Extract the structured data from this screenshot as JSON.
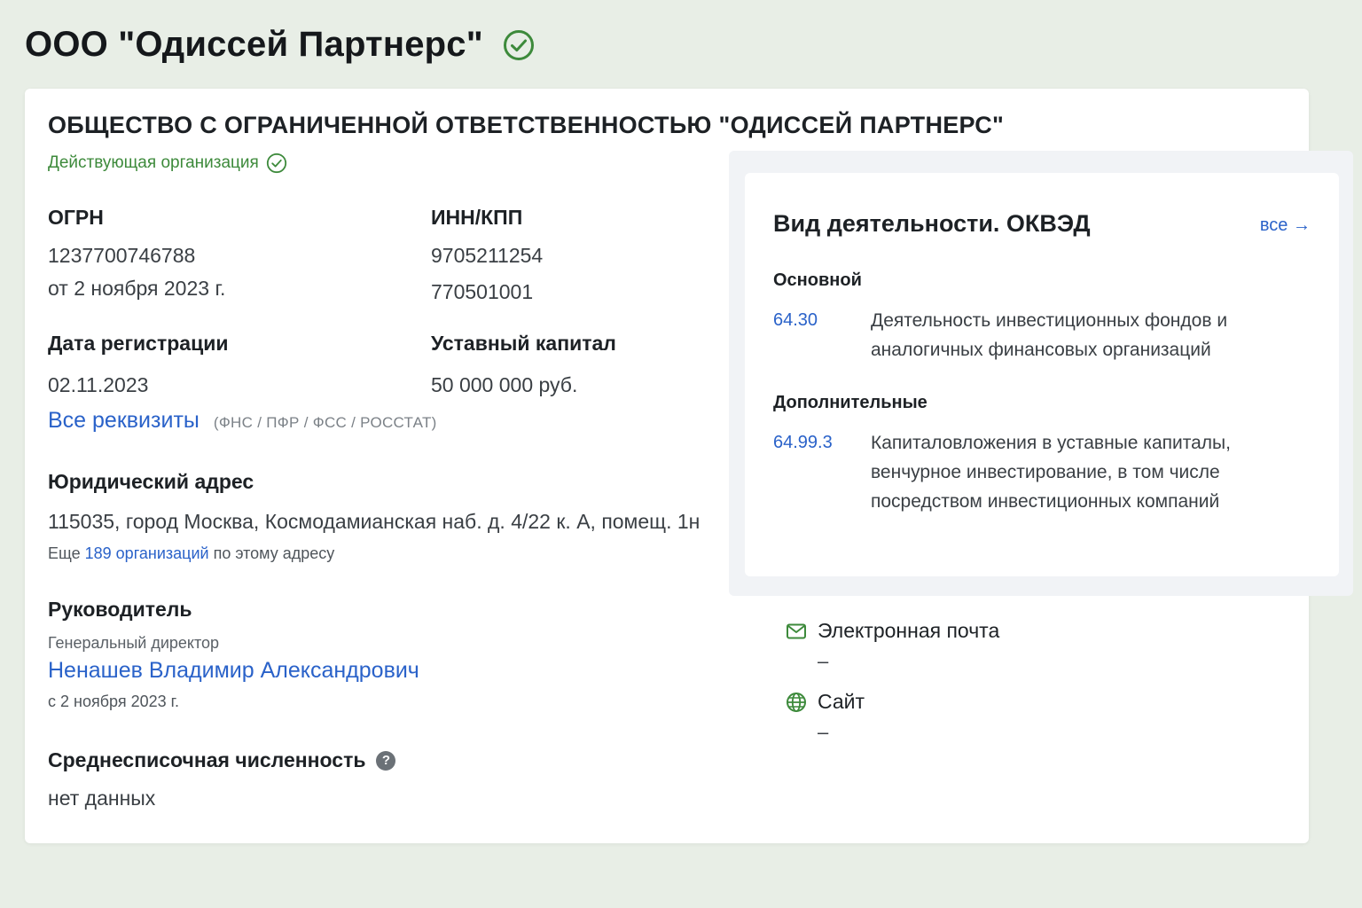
{
  "header": {
    "title": "ООО \"Одиссей Партнерс\""
  },
  "company": {
    "full_name": "ОБЩЕСТВО С ОГРАНИЧЕННОЙ ОТВЕТСТВЕННОСТЬЮ \"ОДИССЕЙ ПАРТНЕРС\"",
    "status": "Действующая организация",
    "ogrn": {
      "label": "ОГРН",
      "value": "1237700746788",
      "date": "от 2 ноября 2023 г."
    },
    "inn_kpp": {
      "label": "ИНН/КПП",
      "inn": "9705211254",
      "kpp": "770501001"
    },
    "registration": {
      "label": "Дата регистрации",
      "value": "02.11.2023"
    },
    "capital": {
      "label": "Уставный капитал",
      "value": "50 000 000 руб."
    },
    "requisites": {
      "link": "Все реквизиты",
      "sources": "(ФНС / ПФР / ФСС / РОССТАТ)"
    },
    "address": {
      "label": "Юридический адрес",
      "value": "115035, город Москва, Космодамианская наб. д. 4/22 к. А, помещ. 1н",
      "more_prefix": "Еще",
      "more_link": "189 организаций",
      "more_suffix": "по этому адресу"
    },
    "head": {
      "label": "Руководитель",
      "role": "Генеральный директор",
      "name": "Ненашев Владимир Александрович",
      "since": "с 2 ноября 2023 г."
    },
    "staff": {
      "label": "Среднесписочная численность",
      "help": "?",
      "value": "нет данных"
    }
  },
  "okved": {
    "title": "Вид деятельности. ОКВЭД",
    "all_link": "все →",
    "main_label": "Основной",
    "main": {
      "code": "64.30",
      "description": "Деятельность инвестиционных фондов и аналогичных финансовых организаций"
    },
    "extra_label": "Дополнительные",
    "extra": {
      "code": "64.99.3",
      "description": "Капиталовложения в уставные капиталы, венчурное инвестирование, в том числе посредством инвестиционных компаний"
    }
  },
  "contacts": {
    "email": {
      "label": "Электронная почта",
      "value": "–",
      "icon": "mail-icon"
    },
    "site": {
      "label": "Сайт",
      "value": "–",
      "icon": "globe-icon"
    }
  },
  "colors": {
    "background": "#e8eee6",
    "accent_green": "#3d8a3b",
    "link_blue": "#2a62c9"
  }
}
